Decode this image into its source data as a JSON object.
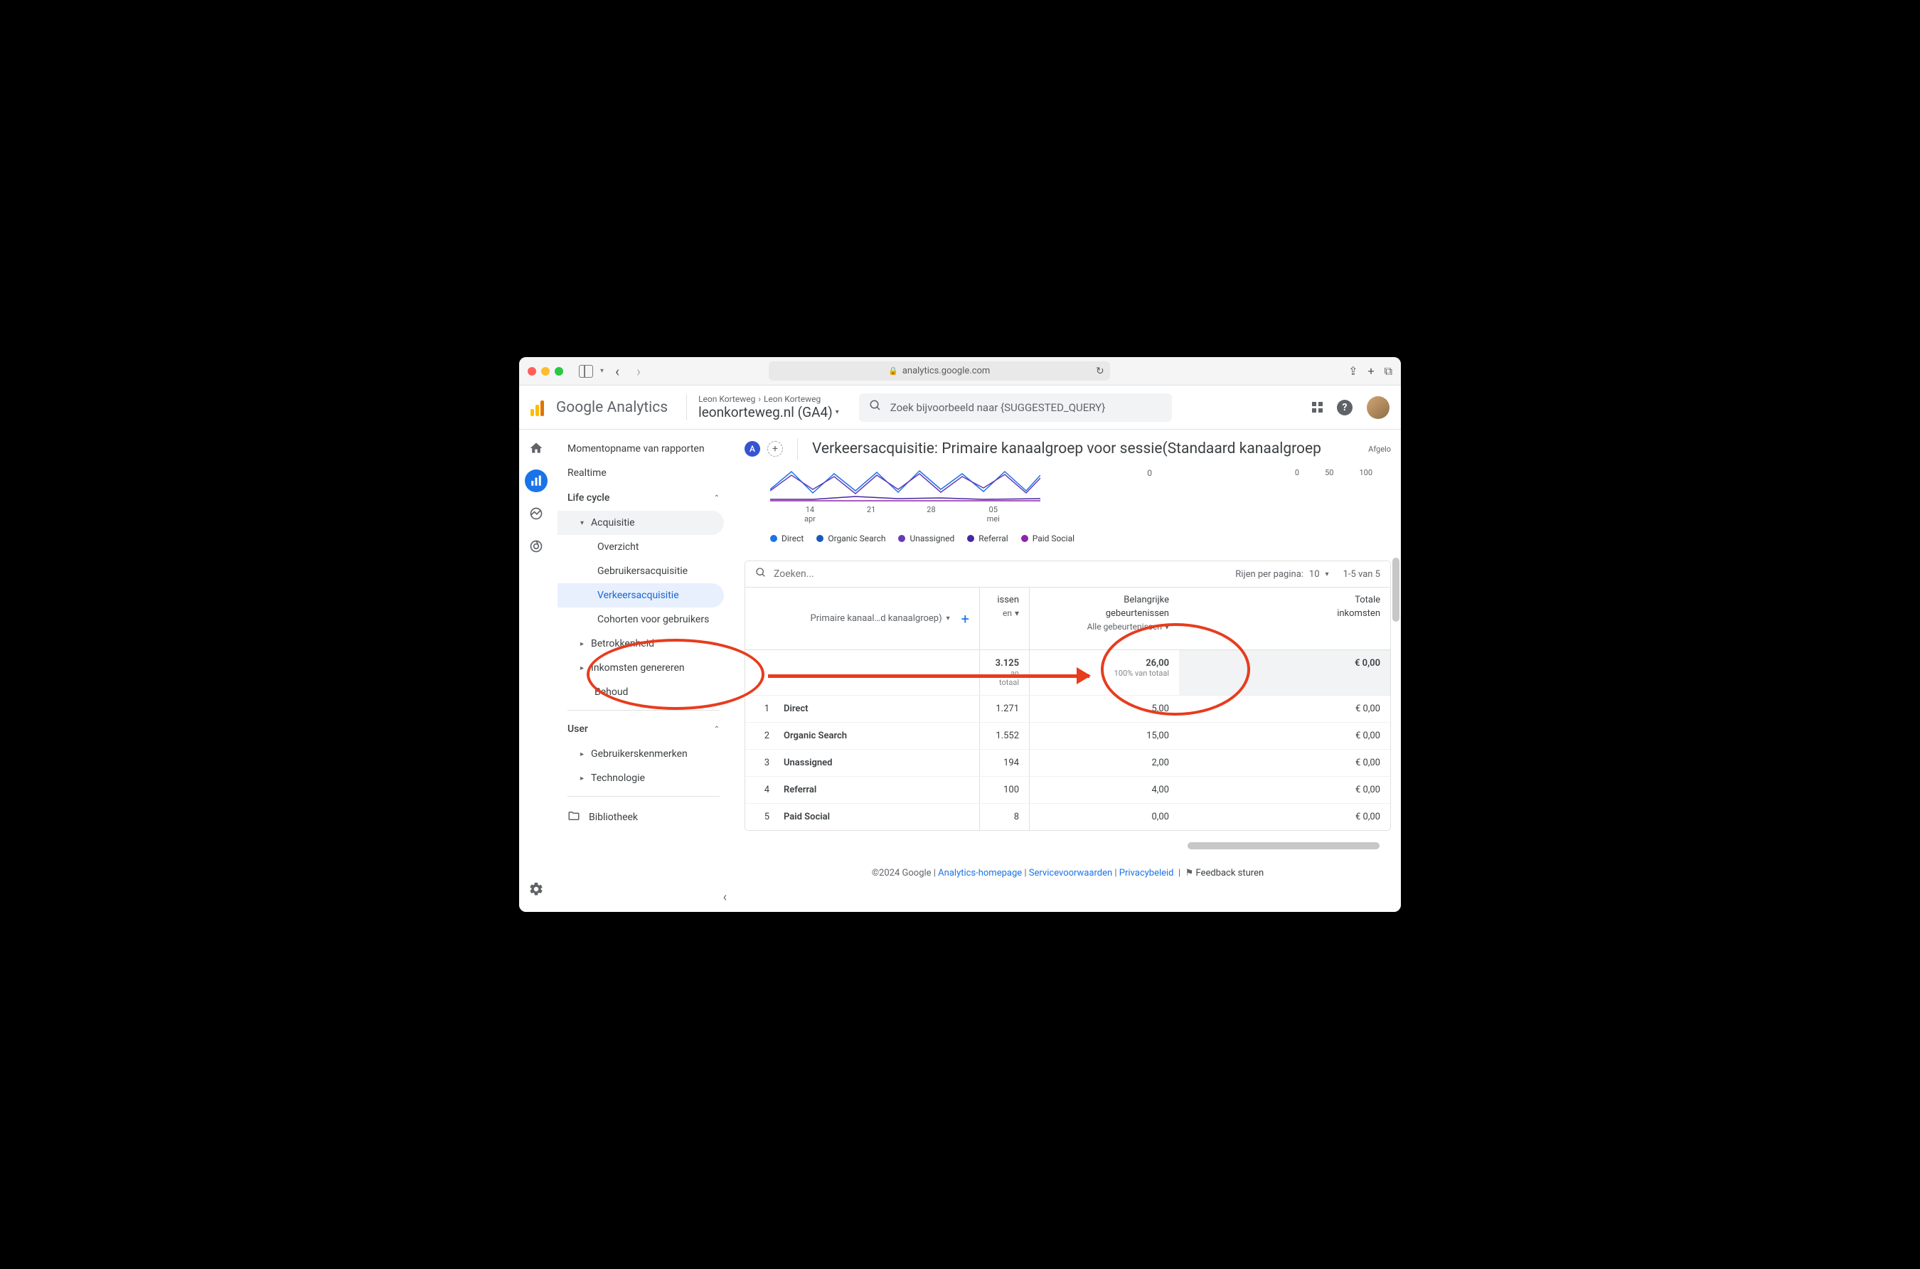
{
  "browser": {
    "url": "analytics.google.com"
  },
  "header": {
    "app_name": "Google Analytics",
    "breadcrumb": [
      "Leon Korteweg",
      "Leon Korteweg"
    ],
    "property": "leonkorteweg.nl (GA4)",
    "search_placeholder": "Zoek bijvoorbeeld naar {SUGGESTED_QUERY}"
  },
  "sidebar": {
    "snapshot": "Momentopname van rapporten",
    "realtime": "Realtime",
    "lifecycle_header": "Life cycle",
    "acquisition": "Acquisitie",
    "acquisition_items": {
      "overview": "Overzicht",
      "user_acq": "Gebruikersacquisitie",
      "traffic_acq": "Verkeersacquisitie",
      "cohorts": "Cohorten voor gebruikers"
    },
    "engagement": "Betrokkenheid",
    "monetization": "Inkomsten genereren",
    "retention": "Behoud",
    "user_header": "User",
    "user_attributes": "Gebruikerskenmerken",
    "technology": "Technologie",
    "library": "Bibliotheek"
  },
  "content": {
    "title": "Verkeersacquisitie: Primaire kanaalgroep voor sessie(Standaard kanaalgroep",
    "right_tag": "Afgelo",
    "chart": {
      "xlabels": [
        {
          "top": "14",
          "bottom": "apr"
        },
        {
          "top": "21",
          "bottom": ""
        },
        {
          "top": "28",
          "bottom": ""
        },
        {
          "top": "05",
          "bottom": "mei"
        }
      ],
      "secondary_zero": "0",
      "secondary_ticks": [
        "0",
        "50",
        "100"
      ],
      "legend": [
        {
          "label": "Direct",
          "color": "#1a73e8"
        },
        {
          "label": "Organic Search",
          "color": "#185abc"
        },
        {
          "label": "Unassigned",
          "color": "#673ab7"
        },
        {
          "label": "Referral",
          "color": "#4527a0"
        },
        {
          "label": "Paid Social",
          "color": "#8e24aa"
        }
      ]
    },
    "table": {
      "search_placeholder": "Zoeken...",
      "rows_per_page_label": "Rijen per pagina:",
      "rows_per_page_value": "10",
      "page_info": "1-5 van 5",
      "dimension_header": "Primaire kanaal…d kanaalgroep)",
      "col_truncated_top": "issen",
      "col_truncated_bottom": "en",
      "col_events_top": "Belangrijke",
      "col_events_bottom": "gebeurtenissen",
      "col_events_filter": "Alle gebeurtenissen",
      "col_income_top": "Totale",
      "col_income_bottom": "inkomsten",
      "totals": {
        "m1": "3.125",
        "m1_sub": "an totaal",
        "m2": "26,00",
        "m2_sub": "100% van totaal",
        "m3": "€ 0,00"
      },
      "rows": [
        {
          "idx": "1",
          "dim": "Direct",
          "m1": "1.271",
          "m2": "5,00",
          "m3": "€ 0,00"
        },
        {
          "idx": "2",
          "dim": "Organic Search",
          "m1": "1.552",
          "m2": "15,00",
          "m3": "€ 0,00"
        },
        {
          "idx": "3",
          "dim": "Unassigned",
          "m1": "194",
          "m2": "2,00",
          "m3": "€ 0,00"
        },
        {
          "idx": "4",
          "dim": "Referral",
          "m1": "100",
          "m2": "4,00",
          "m3": "€ 0,00"
        },
        {
          "idx": "5",
          "dim": "Paid Social",
          "m1": "8",
          "m2": "0,00",
          "m3": "€ 0,00"
        }
      ]
    }
  },
  "footer": {
    "copyright": "©2024 Google",
    "homepage": "Analytics-homepage",
    "terms": "Servicevoorwaarden",
    "privacy": "Privacybeleid",
    "feedback": "Feedback sturen"
  }
}
